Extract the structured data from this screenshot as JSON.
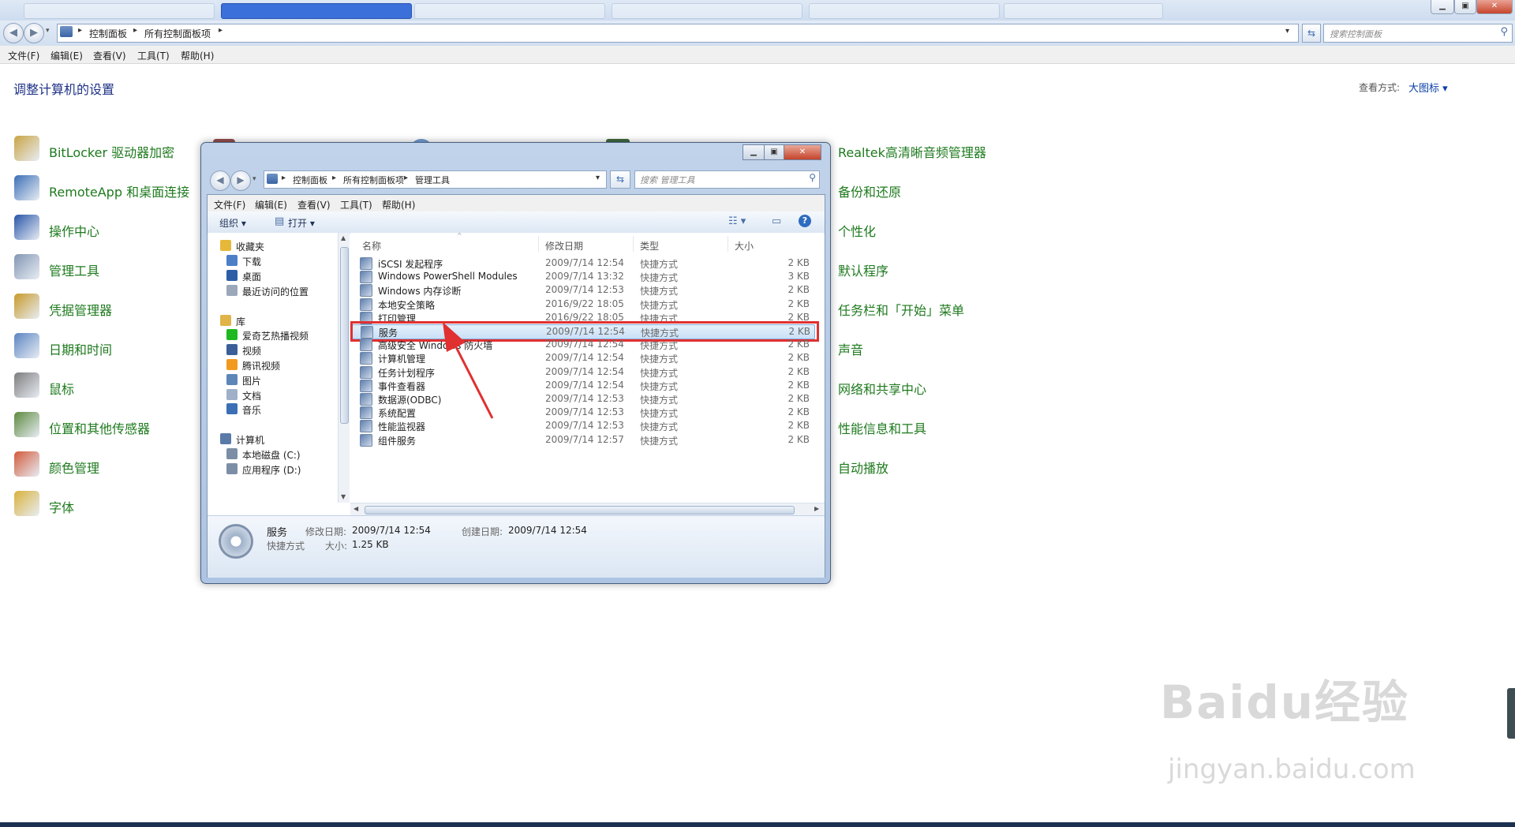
{
  "address": {
    "segments": [
      "控制面板",
      "所有控制面板项"
    ]
  },
  "search": {
    "placeholder": "搜索控制面板"
  },
  "menu": [
    "文件(F)",
    "编辑(E)",
    "查看(V)",
    "工具(T)",
    "帮助(H)"
  ],
  "page": {
    "title": "调整计算机的设置",
    "view_by_label": "查看方式:",
    "view_by_value": "大图标 ▾"
  },
  "cp_left": [
    {
      "label": "BitLocker 驱动器加密",
      "icon": "bitlocker-icon",
      "color": "#c9a443"
    },
    {
      "label": "RemoteApp 和桌面连接",
      "icon": "remoteapp-icon",
      "color": "#3c6fb5"
    },
    {
      "label": "操作中心",
      "icon": "flag-icon",
      "color": "#2855a8"
    },
    {
      "label": "管理工具",
      "icon": "admin-tools-icon",
      "color": "#8296b3"
    },
    {
      "label": "凭据管理器",
      "icon": "credential-icon",
      "color": "#c79a2a"
    },
    {
      "label": "日期和时间",
      "icon": "clock-icon",
      "color": "#5b84c1"
    },
    {
      "label": "鼠标",
      "icon": "mouse-icon",
      "color": "#7d7d7d"
    },
    {
      "label": "位置和其他传感器",
      "icon": "sensor-icon",
      "color": "#5c8a3d"
    },
    {
      "label": "颜色管理",
      "icon": "color-icon",
      "color": "#d25a3a"
    },
    {
      "label": "字体",
      "icon": "font-icon",
      "color": "#d9b23b"
    }
  ],
  "cp_right": [
    "Realtek高清晰音频管理器",
    "备份和还原",
    "个性化",
    "默认程序",
    "任务栏和「开始」菜单",
    "声音",
    "网络和共享中心",
    "性能信息和工具",
    "自动播放"
  ],
  "explorer": {
    "address": [
      "控制面板",
      "所有控制面板项",
      "管理工具"
    ],
    "search_placeholder": "搜索 管理工具",
    "menu": [
      "文件(F)",
      "编辑(E)",
      "查看(V)",
      "工具(T)",
      "帮助(H)"
    ],
    "toolbar": {
      "organize": "组织 ▾",
      "open": "打开 ▾"
    },
    "nav": [
      {
        "label": "收藏夹",
        "icon": "star-icon",
        "color": "#e6b83a",
        "indent": 0
      },
      {
        "label": "下载",
        "icon": "download-folder-icon",
        "color": "#4d7fc9",
        "indent": 1
      },
      {
        "label": "桌面",
        "icon": "desktop-icon",
        "color": "#2e5da6",
        "indent": 1
      },
      {
        "label": "最近访问的位置",
        "icon": "recent-icon",
        "color": "#9aa8ba",
        "indent": 1
      },
      {
        "label": "库",
        "icon": "library-icon",
        "color": "#e0b447",
        "indent": 0
      },
      {
        "label": "爱奇艺热播视频",
        "icon": "iqiyi-icon",
        "color": "#20b820",
        "indent": 1
      },
      {
        "label": "视频",
        "icon": "video-icon",
        "color": "#3a5f98",
        "indent": 1
      },
      {
        "label": "腾讯视频",
        "icon": "tencent-video-icon",
        "color": "#f29a1f",
        "indent": 1
      },
      {
        "label": "图片",
        "icon": "pictures-icon",
        "color": "#5d86b8",
        "indent": 1
      },
      {
        "label": "文档",
        "icon": "documents-icon",
        "color": "#9fb0c8",
        "indent": 1
      },
      {
        "label": "音乐",
        "icon": "music-icon",
        "color": "#3a6fb5",
        "indent": 1
      },
      {
        "label": "计算机",
        "icon": "computer-icon",
        "color": "#5a7ba8",
        "indent": 0
      },
      {
        "label": "本地磁盘 (C:)",
        "icon": "disk-icon",
        "color": "#7c8ea6",
        "indent": 1
      },
      {
        "label": "应用程序 (D:)",
        "icon": "disk-icon",
        "color": "#7c8ea6",
        "indent": 1
      }
    ],
    "columns": [
      "名称",
      "修改日期",
      "类型",
      "大小"
    ],
    "files": [
      {
        "name": "iSCSI 发起程序",
        "date": "2009/7/14 12:54",
        "type": "快捷方式",
        "size": "2 KB"
      },
      {
        "name": "Windows PowerShell Modules",
        "date": "2009/7/14 13:32",
        "type": "快捷方式",
        "size": "3 KB"
      },
      {
        "name": "Windows 内存诊断",
        "date": "2009/7/14 12:53",
        "type": "快捷方式",
        "size": "2 KB"
      },
      {
        "name": "本地安全策略",
        "date": "2016/9/22 18:05",
        "type": "快捷方式",
        "size": "2 KB"
      },
      {
        "name": "打印管理",
        "date": "2016/9/22 18:05",
        "type": "快捷方式",
        "size": "2 KB"
      },
      {
        "name": "服务",
        "date": "2009/7/14 12:54",
        "type": "快捷方式",
        "size": "2 KB"
      },
      {
        "name": "高级安全 Windows 防火墙",
        "date": "2009/7/14 12:54",
        "type": "快捷方式",
        "size": "2 KB"
      },
      {
        "name": "计算机管理",
        "date": "2009/7/14 12:54",
        "type": "快捷方式",
        "size": "2 KB"
      },
      {
        "name": "任务计划程序",
        "date": "2009/7/14 12:54",
        "type": "快捷方式",
        "size": "2 KB"
      },
      {
        "name": "事件查看器",
        "date": "2009/7/14 12:54",
        "type": "快捷方式",
        "size": "2 KB"
      },
      {
        "name": "数据源(ODBC)",
        "date": "2009/7/14 12:53",
        "type": "快捷方式",
        "size": "2 KB"
      },
      {
        "name": "系统配置",
        "date": "2009/7/14 12:53",
        "type": "快捷方式",
        "size": "2 KB"
      },
      {
        "name": "性能监视器",
        "date": "2009/7/14 12:53",
        "type": "快捷方式",
        "size": "2 KB"
      },
      {
        "name": "组件服务",
        "date": "2009/7/14 12:57",
        "type": "快捷方式",
        "size": "2 KB"
      }
    ],
    "selected_index": 5,
    "details": {
      "name": "服务",
      "type": "快捷方式",
      "modified_label": "修改日期:",
      "modified": "2009/7/14 12:54",
      "created_label": "创建日期:",
      "created": "2009/7/14 12:54",
      "size_label": "大小:",
      "size": "1.25 KB"
    }
  },
  "watermark": {
    "text": "Baidu经验",
    "sub": "jingyan.baidu.com"
  },
  "colors": {
    "link_green": "#1e7a1e",
    "title_blue": "#1e3287",
    "highlight_red": "#e03030"
  }
}
